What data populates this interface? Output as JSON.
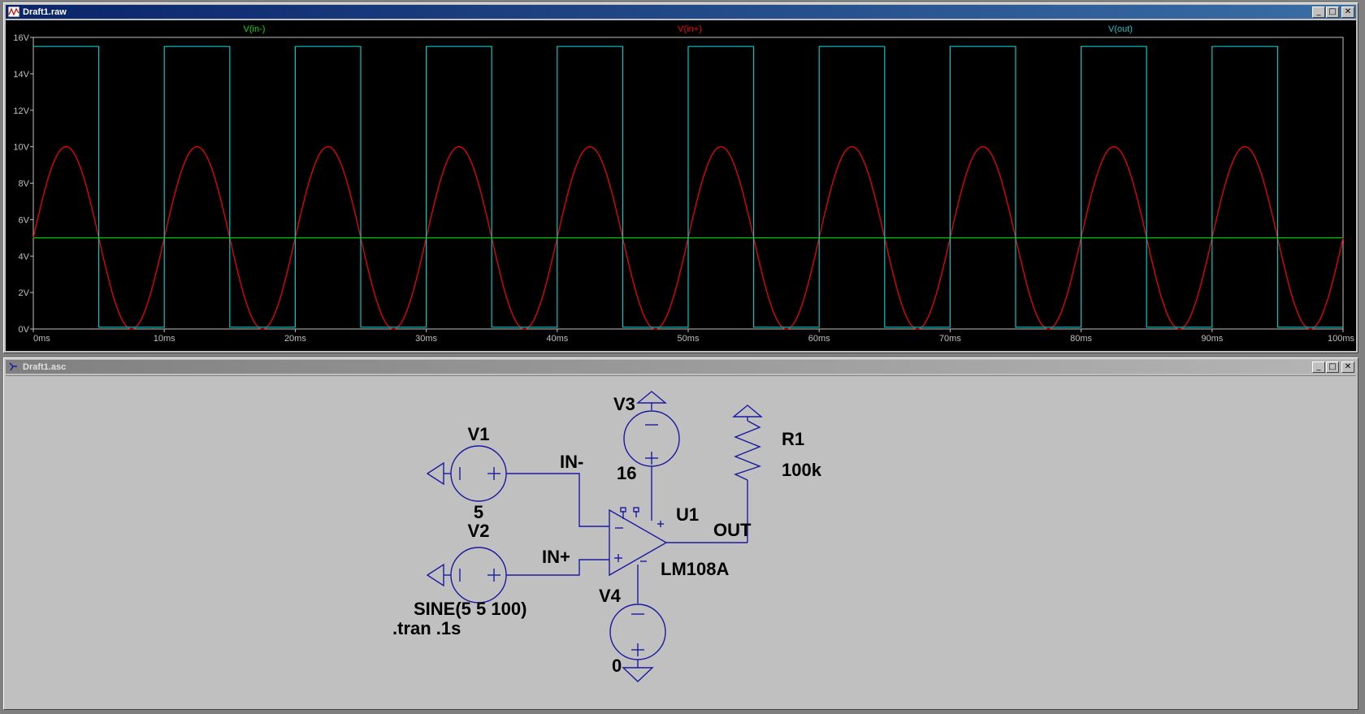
{
  "plot_window": {
    "title": "Draft1.raw",
    "buttons": {
      "minimize": "_",
      "maximize": "□",
      "close": "✕"
    },
    "trace_labels": [
      {
        "name": "V(in-)",
        "color": "#00e000"
      },
      {
        "name": "V(in+)",
        "color": "#ff0000"
      },
      {
        "name": "V(out)",
        "color": "#00c8c8"
      }
    ]
  },
  "schematic_window": {
    "title": "Draft1.asc",
    "buttons": {
      "minimize": "_",
      "maximize": "□",
      "close": "✕"
    },
    "components": {
      "v1": {
        "name": "V1",
        "value": "5"
      },
      "v2": {
        "name": "V2",
        "value": "SINE(5 5 100)"
      },
      "v3": {
        "name": "V3",
        "value": "16"
      },
      "v4": {
        "name": "V4",
        "value": "0"
      },
      "u1": {
        "name": "U1",
        "value": "LM108A"
      },
      "r1": {
        "name": "R1",
        "value": "100k"
      }
    },
    "net_labels": {
      "in_minus": "IN-",
      "in_plus": "IN+",
      "out": "OUT"
    },
    "directive": ".tran .1s",
    "wire_color": "#1a1aa0"
  },
  "chart_data": {
    "type": "line",
    "xlabel": "",
    "ylabel": "",
    "xlim": [
      0,
      100
    ],
    "ylim": [
      0,
      16
    ],
    "x_ticks": [
      "0ms",
      "10ms",
      "20ms",
      "30ms",
      "40ms",
      "50ms",
      "60ms",
      "70ms",
      "80ms",
      "90ms",
      "100ms"
    ],
    "y_ticks": [
      "0V",
      "2V",
      "4V",
      "6V",
      "8V",
      "10V",
      "12V",
      "14V",
      "16V"
    ],
    "grid": false,
    "legend": "top",
    "series": [
      {
        "name": "V(in-)",
        "color": "#00e000",
        "kind": "constant",
        "value": 5
      },
      {
        "name": "V(in+)",
        "color": "#ff0000",
        "kind": "sine",
        "offset": 5,
        "amplitude": 5,
        "frequency_hz": 100
      },
      {
        "name": "V(out)",
        "color": "#00c8c8",
        "kind": "square",
        "high": 15.5,
        "low": 0.1,
        "period_ms": 10,
        "high_ms": 5
      }
    ]
  }
}
